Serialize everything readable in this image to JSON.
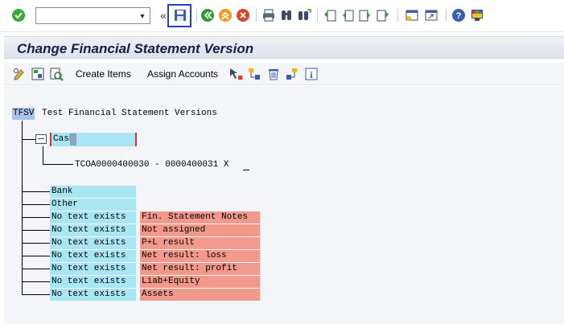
{
  "toolbar": {
    "command_value": "",
    "icons": [
      "enter-icon",
      "save-icon",
      "back-icon",
      "exit-icon",
      "cancel-icon",
      "print-icon",
      "find-icon",
      "find-next-icon",
      "first-page-icon",
      "previous-page-icon",
      "next-page-icon",
      "last-page-icon",
      "create-session-icon",
      "shortcut-icon",
      "help-icon",
      "customize-layout-icon"
    ],
    "expand_glyph": "«"
  },
  "title": "Change Financial Statement Version",
  "app_toolbar": {
    "create_items": "Create Items",
    "assign_accounts": "Assign Accounts"
  },
  "tree": {
    "root_code": "TFSV",
    "root_text": "Test Financial Statement Versions",
    "cash": {
      "label": "Cash",
      "range": "TCOA0000400030 - 0000400031 X"
    },
    "items": [
      {
        "label": "Bank",
        "note": ""
      },
      {
        "label": "Other",
        "note": ""
      },
      {
        "label": "No text exists",
        "note": "Fin. Statement Notes"
      },
      {
        "label": "No text exists",
        "note": "Not assigned"
      },
      {
        "label": "No text exists",
        "note": "P+L result"
      },
      {
        "label": "No text exists",
        "note": "Net result: loss"
      },
      {
        "label": "No text exists",
        "note": "Net result: profit"
      },
      {
        "label": "No text exists",
        "note": "Liab+Equity"
      },
      {
        "label": "No text exists",
        "note": "Assets"
      }
    ]
  },
  "colors": {
    "node_highlight": "#a9e6f3",
    "note_highlight": "#f3998b",
    "title_text": "#10204a",
    "save_frame": "#2a3fb4"
  }
}
